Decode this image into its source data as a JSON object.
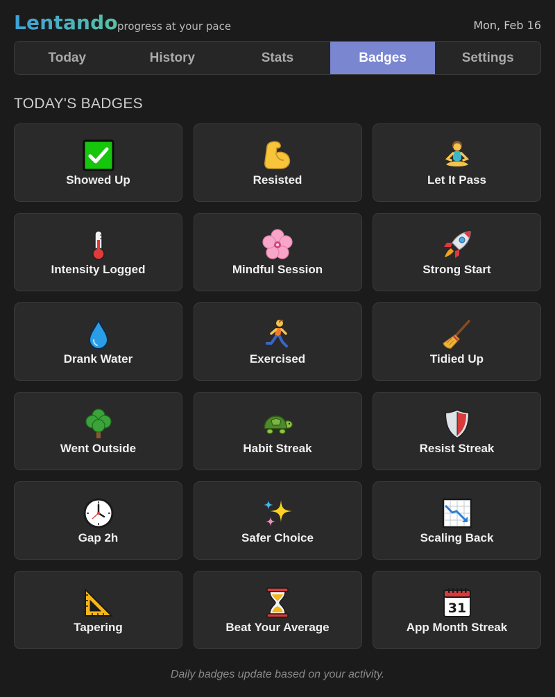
{
  "app": {
    "name": "Lentando",
    "tagline": "progress at your pace",
    "date": "Mon, Feb 16"
  },
  "tabs": [
    {
      "label": "Today",
      "active": false
    },
    {
      "label": "History",
      "active": false
    },
    {
      "label": "Stats",
      "active": false
    },
    {
      "label": "Badges",
      "active": true
    },
    {
      "label": "Settings",
      "active": false
    }
  ],
  "section": {
    "title": "TODAY'S BADGES"
  },
  "badges": [
    {
      "label": "Showed Up",
      "icon": "check-mark-icon"
    },
    {
      "label": "Resisted",
      "icon": "flexed-biceps-icon"
    },
    {
      "label": "Let It Pass",
      "icon": "lotus-position-icon"
    },
    {
      "label": "Intensity Logged",
      "icon": "thermometer-icon"
    },
    {
      "label": "Mindful Session",
      "icon": "cherry-blossom-icon"
    },
    {
      "label": "Strong Start",
      "icon": "rocket-icon"
    },
    {
      "label": "Drank Water",
      "icon": "droplet-icon"
    },
    {
      "label": "Exercised",
      "icon": "running-person-icon"
    },
    {
      "label": "Tidied Up",
      "icon": "broom-icon"
    },
    {
      "label": "Went Outside",
      "icon": "tree-icon"
    },
    {
      "label": "Habit Streak",
      "icon": "turtle-icon"
    },
    {
      "label": "Resist Streak",
      "icon": "shield-icon"
    },
    {
      "label": "Gap 2h",
      "icon": "clock-icon"
    },
    {
      "label": "Safer Choice",
      "icon": "sparkles-icon"
    },
    {
      "label": "Scaling Back",
      "icon": "chart-decreasing-icon"
    },
    {
      "label": "Tapering",
      "icon": "triangular-ruler-icon"
    },
    {
      "label": "Beat Your Average",
      "icon": "hourglass-icon"
    },
    {
      "label": "App Month Streak",
      "icon": "calendar-icon"
    }
  ],
  "footer": {
    "text": "Daily badges update based on your activity."
  },
  "colors": {
    "accent": "#7a86d0",
    "background": "#1b1b1b",
    "card": "#2a2a2a",
    "brand_start": "#3ea0d8",
    "brand_end": "#57c2a4"
  }
}
